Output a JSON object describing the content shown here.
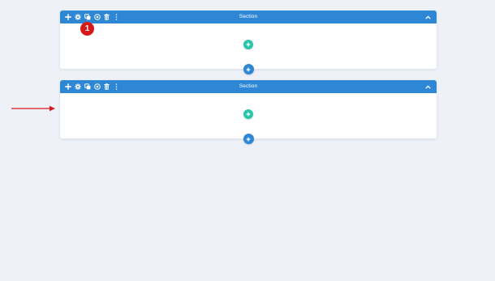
{
  "sections": [
    {
      "title": "Section"
    },
    {
      "title": "Section"
    }
  ],
  "annotation": {
    "step_number": "1"
  },
  "toolbar_icons": [
    "move-icon",
    "settings-icon",
    "duplicate-icon",
    "power-icon",
    "trash-icon",
    "more-icon"
  ],
  "colors": {
    "header": "#2e87d5",
    "add_row": "#29c4a9",
    "add_section": "#2e87d5",
    "badge": "#d7191a",
    "arrow": "#d7191a",
    "background": "#eef1f7"
  }
}
